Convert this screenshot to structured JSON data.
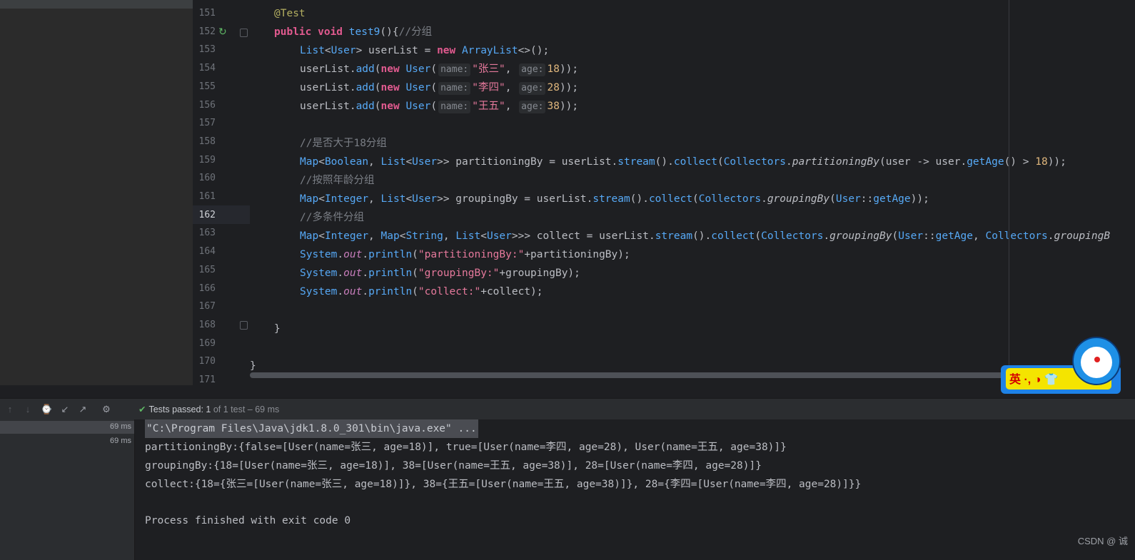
{
  "editor": {
    "lines": [
      {
        "num": "151",
        "content": "@Test"
      },
      {
        "num": "152",
        "content": "public void test9(){//分组"
      },
      {
        "num": "153",
        "content": "List<User> userList = new ArrayList<>();"
      },
      {
        "num": "154",
        "content": "userList.add(new User( name: \"张三\", age: 18));"
      },
      {
        "num": "155",
        "content": "userList.add(new User( name: \"李四\", age: 28));"
      },
      {
        "num": "156",
        "content": "userList.add(new User( name: \"王五\", age: 38));"
      },
      {
        "num": "157",
        "content": ""
      },
      {
        "num": "158",
        "content": "//是否大于18分组"
      },
      {
        "num": "159",
        "content": "Map<Boolean, List<User>> partitioningBy = userList.stream().collect(Collectors.partitioningBy(user -> user.getAge() > 18));"
      },
      {
        "num": "160",
        "content": "//按照年龄分组"
      },
      {
        "num": "161",
        "content": "Map<Integer, List<User>> groupingBy = userList.stream().collect(Collectors.groupingBy(User::getAge));"
      },
      {
        "num": "162",
        "content": "//多条件分组"
      },
      {
        "num": "163",
        "content": "Map<Integer, Map<String, List<User>>> collect = userList.stream().collect(Collectors.groupingBy(User::getAge, Collectors.groupingB"
      },
      {
        "num": "164",
        "content": "System.out.println(\"partitioningBy:\"+partitioningBy);"
      },
      {
        "num": "165",
        "content": "System.out.println(\"groupingBy:\"+groupingBy);"
      },
      {
        "num": "166",
        "content": "System.out.println(\"collect:\"+collect);"
      },
      {
        "num": "167",
        "content": ""
      },
      {
        "num": "168",
        "content": "}"
      },
      {
        "num": "169",
        "content": ""
      },
      {
        "num": "170",
        "content": "}"
      },
      {
        "num": "171",
        "content": ""
      }
    ],
    "current_line": "162"
  },
  "run_panel": {
    "status_label": "Tests passed:",
    "status_count": "1",
    "status_of": "of 1 test – 69 ms",
    "tree_times": [
      "69 ms",
      "69 ms"
    ],
    "console": [
      "\"C:\\Program Files\\Java\\jdk1.8.0_301\\bin\\java.exe\" ...",
      "partitioningBy:{false=[User(name=张三, age=18)], true=[User(name=李四, age=28), User(name=王五, age=38)]}",
      "groupingBy:{18=[User(name=张三, age=18)], 38=[User(name=王五, age=38)], 28=[User(name=李四, age=28)]}",
      "collect:{18={张三=[User(name=张三, age=18)]}, 38={王五=[User(name=王五, age=38)]}, 28={李四=[User(name=李四, age=28)]}}",
      "",
      "Process finished with exit code 0"
    ]
  },
  "sticker": {
    "text": "英 ·, ◑ 👕"
  },
  "watermark": "CSDN @ 诚",
  "colors": {
    "keyword": "#cf8e6d",
    "type": "#56a8f5",
    "string": "#6aab73",
    "number": "#e0b77d",
    "comment": "#7a7e85",
    "passed": "#5fb865"
  }
}
